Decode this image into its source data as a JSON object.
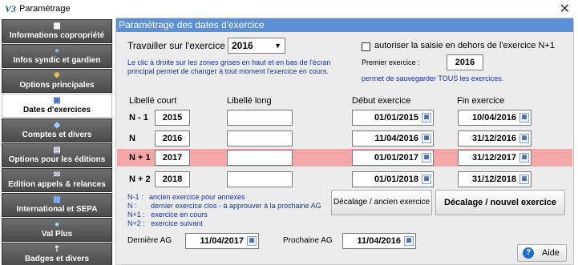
{
  "window": {
    "title": "Paramétrage",
    "app_icon": "V3"
  },
  "sidebar": {
    "items": [
      {
        "label": "Informations copropriété",
        "icon": "building-icon"
      },
      {
        "label": "Infos syndic et gardien",
        "icon": "help-icon"
      },
      {
        "label": "Options principales",
        "icon": "gear-icon"
      },
      {
        "label": "Dates d'exercices",
        "icon": "calendar-icon"
      },
      {
        "label": "Comptes et divers",
        "icon": "accounts-icon"
      },
      {
        "label": "Options pour les éditions",
        "icon": "document-icon"
      },
      {
        "label": "Edition appels & relances",
        "icon": "mail-icon"
      },
      {
        "label": "International et SEPA",
        "icon": "sepa-icon"
      },
      {
        "label": "Val Plus",
        "icon": "val-plus-icon"
      },
      {
        "label": "Badges et divers",
        "icon": "badge-icon"
      }
    ],
    "active_index": 3
  },
  "panel": {
    "header": "Paramétrage des dates d'exercice",
    "work_on_label": "Travailler sur l'exercice",
    "work_on_value": "2016",
    "note_line1": "Le clic à droite sur les zones grises en haut et en bas de l'écran",
    "note_line2": "principal permet de changer à tout moment l'exercice en cours.",
    "allow_label": "autoriser la saisie en dehors de l'exercice N+1",
    "allow_checked": false,
    "first_label": "Premier exercice :",
    "first_value": "2016",
    "save_note": "permet de sauvegarder TOUS les exercices.",
    "columns": {
      "short": "Libellé court",
      "long": "Libellé long",
      "start": "Début exercice",
      "end": "Fin exercice"
    },
    "rows": [
      {
        "label": "N - 1",
        "short": "2015",
        "long": "",
        "start": "01/01/2015",
        "end": "10/04/2016"
      },
      {
        "label": "N",
        "short": "2016",
        "long": "",
        "start": "11/04/2016",
        "end": "31/12/2016"
      },
      {
        "label": "N + 1",
        "short": "2017",
        "long": "",
        "start": "01/01/2017",
        "end": "31/12/2017"
      },
      {
        "label": "N + 2",
        "short": "2018",
        "long": "",
        "start": "01/01/2018",
        "end": "31/12/2018"
      }
    ],
    "highlight_row_color": "#f5a6a6",
    "legend": [
      "N-1 :   ancien exercice pour annexes",
      "N :       dernier exercice clos - à approuver à la prochaine AG",
      "N+1 :   exercice en cours",
      "N+2 :   exercice suivant"
    ],
    "btn_shift_old": "Décalage / ancien exercice",
    "btn_shift_new": "Décalage / nouvel exercice",
    "last_ag_label": "Dernière AG",
    "last_ag_value": "11/04/2017",
    "next_ag_label": "Prochaine AG",
    "next_ag_value": "11/04/2016",
    "help_label": "Aide"
  },
  "colors": {
    "header_blue": "#5b8fd6",
    "note_blue": "#1535a8",
    "sidebar_dark": "#555555"
  }
}
